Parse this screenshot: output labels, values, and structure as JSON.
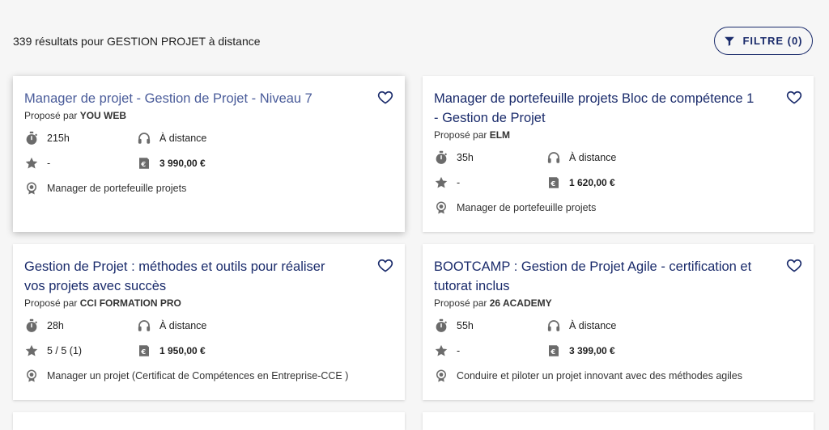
{
  "header": {
    "results_text": "339 résultats pour GESTION PROJET à distance",
    "filter_label": "FILTRE (0)"
  },
  "proposed_prefix": "Proposé par",
  "colors": {
    "primary": "#1a2b6b",
    "icon": "#6b6b6b",
    "background": "#f6f6f6"
  },
  "cards": [
    {
      "title": "Manager de projet - Gestion de Projet - Niveau 7",
      "provider": "YOU WEB",
      "duration": "215h",
      "mode": "À distance",
      "rating": "-",
      "price": "3 990,00 €",
      "certification": "Manager de portefeuille projets"
    },
    {
      "title": "Manager de portefeuille projets Bloc de compétence 1 - Gestion de Projet",
      "provider": "ELM",
      "duration": "35h",
      "mode": "À distance",
      "rating": "-",
      "price": "1 620,00 €",
      "certification": "Manager de portefeuille projets"
    },
    {
      "title": "Gestion de Projet : méthodes et outils pour réaliser vos projets avec succès",
      "provider": "CCI FORMATION PRO",
      "duration": "28h",
      "mode": "À distance",
      "rating": "5 / 5 (1)",
      "price": "1 950,00 €",
      "certification": "Manager un projet (Certificat de Compétences en Entreprise-CCE )"
    },
    {
      "title": "BOOTCAMP : Gestion de Projet Agile - certification et tutorat inclus",
      "provider": "26 ACADEMY",
      "duration": "55h",
      "mode": "À distance",
      "rating": "-",
      "price": "3 399,00 €",
      "certification": "Conduire et piloter un projet innovant avec des méthodes agiles"
    }
  ]
}
